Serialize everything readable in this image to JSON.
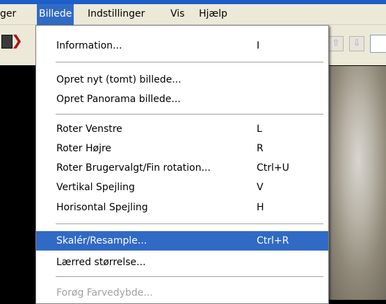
{
  "menubar": {
    "items": [
      {
        "label": "ger"
      },
      {
        "label": "Billede"
      },
      {
        "label": "Indstillinger"
      },
      {
        "label": "Vis"
      },
      {
        "label": "Hjælp"
      }
    ]
  },
  "toolbar": {
    "left_arrow": "❯",
    "up_icon": "⇧",
    "down_icon": "⇩"
  },
  "menu": {
    "items": [
      {
        "label": "Information...",
        "shortcut": "I"
      },
      {
        "label": "Opret nyt (tomt) billede...",
        "shortcut": ""
      },
      {
        "label": "Opret Panorama billede...",
        "shortcut": ""
      },
      {
        "label": "Roter Venstre",
        "shortcut": "L"
      },
      {
        "label": "Roter Højre",
        "shortcut": "R"
      },
      {
        "label": "Roter Brugervalgt/Fin rotation...",
        "shortcut": "Ctrl+U"
      },
      {
        "label": "Vertikal Spejling",
        "shortcut": "V"
      },
      {
        "label": "Horisontal Spejling",
        "shortcut": "H"
      },
      {
        "label": "Skalér/Resample...",
        "shortcut": "Ctrl+R"
      },
      {
        "label": "Lærred størrelse...",
        "shortcut": ""
      },
      {
        "label": "Forøg Farvedybde...",
        "shortcut": ""
      }
    ]
  },
  "colors": {
    "menu_highlight": "#316ac5",
    "menubar_bg": "#ece9d8",
    "title_blue": "#1c5fc8",
    "disabled_text": "#a0a0a0"
  }
}
